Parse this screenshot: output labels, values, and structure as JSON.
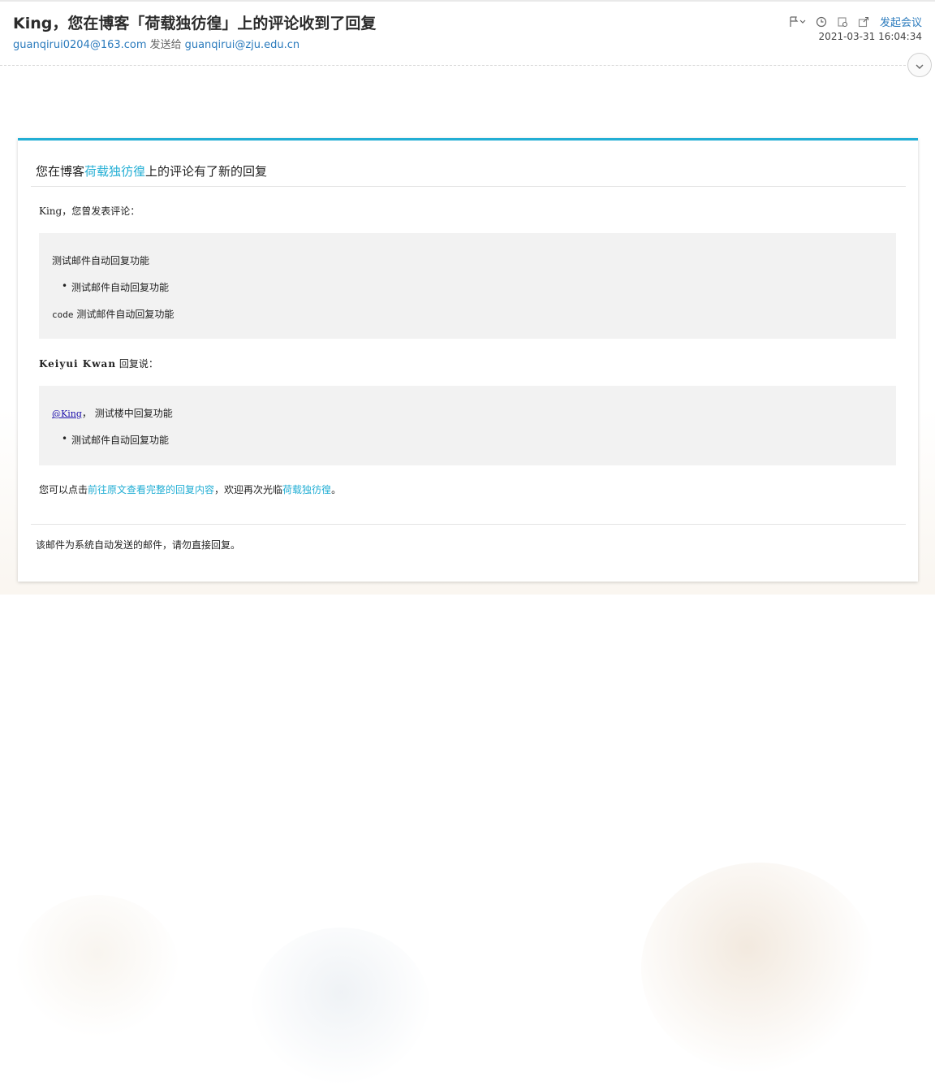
{
  "mail": {
    "subject": "King，您在博客「荷载独彷徨」上的评论收到了回复",
    "from": "guanqirui0204@163.com",
    "send_to_label": "发送给",
    "to": "guanqirui@zju.edu.cn",
    "datetime": "2021-03-31 16:04:34",
    "toolbar": {
      "flag_icon": "flag-icon",
      "dropdown_icon": "chevron-down-icon",
      "clock_icon": "clock-icon",
      "settings_icon": "gear-icon",
      "share_icon": "share-icon",
      "meeting_label": "发起会议"
    },
    "expand_icon": "chevron-down-icon"
  },
  "card": {
    "title_prefix": "您在博客",
    "blog_name": "荷载独彷徨",
    "title_suffix": "上的评论有了新的回复",
    "greeting": "King，您曾发表评论：",
    "original_comment": {
      "line1": "测试邮件自动回复功能",
      "bullet": "测试邮件自动回复功能",
      "code_word": "code",
      "line3": "测试邮件自动回复功能"
    },
    "replier_name": "Keiyui Kwan",
    "replier_suffix": "回复说：",
    "reply": {
      "mention": "@King",
      "text": "， 测试楼中回复功能",
      "bullet": "测试邮件自动回复功能"
    },
    "footer": {
      "prefix": "您可以点击",
      "link_text": "前往原文查看完整的回复内容",
      "middle": "，欢迎再次光临",
      "blog_link": "荷载独彷徨",
      "suffix": "。"
    },
    "auto_note": "该邮件为系统自动发送的邮件，请勿直接回复。"
  },
  "colors": {
    "accent": "#22aed4",
    "link_blue": "#2b7bbd",
    "quote_bg": "#f2f2f2"
  }
}
